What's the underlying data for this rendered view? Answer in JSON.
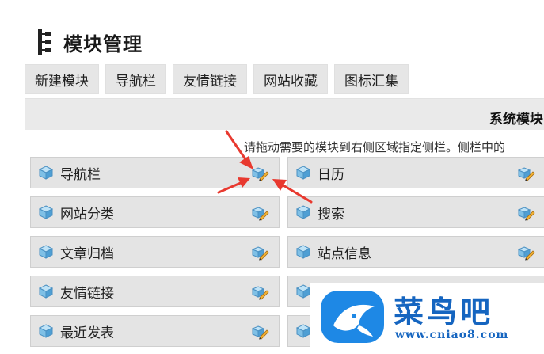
{
  "header": {
    "title": "模块管理"
  },
  "tabs": [
    {
      "label": "新建模块"
    },
    {
      "label": "导航栏"
    },
    {
      "label": "友情链接"
    },
    {
      "label": "网站收藏"
    },
    {
      "label": "图标汇集"
    }
  ],
  "panel": {
    "title": "系统模块",
    "hint": "请拖动需要的模块到右侧区域指定侧栏。侧栏中的"
  },
  "modules": {
    "left": [
      {
        "label": "导航栏"
      },
      {
        "label": "网站分类"
      },
      {
        "label": "文章归档"
      },
      {
        "label": "友情链接"
      },
      {
        "label": "最近发表"
      }
    ],
    "right": [
      {
        "label": "日历"
      },
      {
        "label": "搜索"
      },
      {
        "label": "站点信息"
      },
      {
        "label": ""
      },
      {
        "label": ""
      }
    ]
  },
  "watermark": {
    "name": "菜鸟吧",
    "url": "www.cniao8.com"
  },
  "colors": {
    "arrow": "#e8392f",
    "watermark": "#1565c0",
    "module_bg": "#e4e4e4"
  }
}
